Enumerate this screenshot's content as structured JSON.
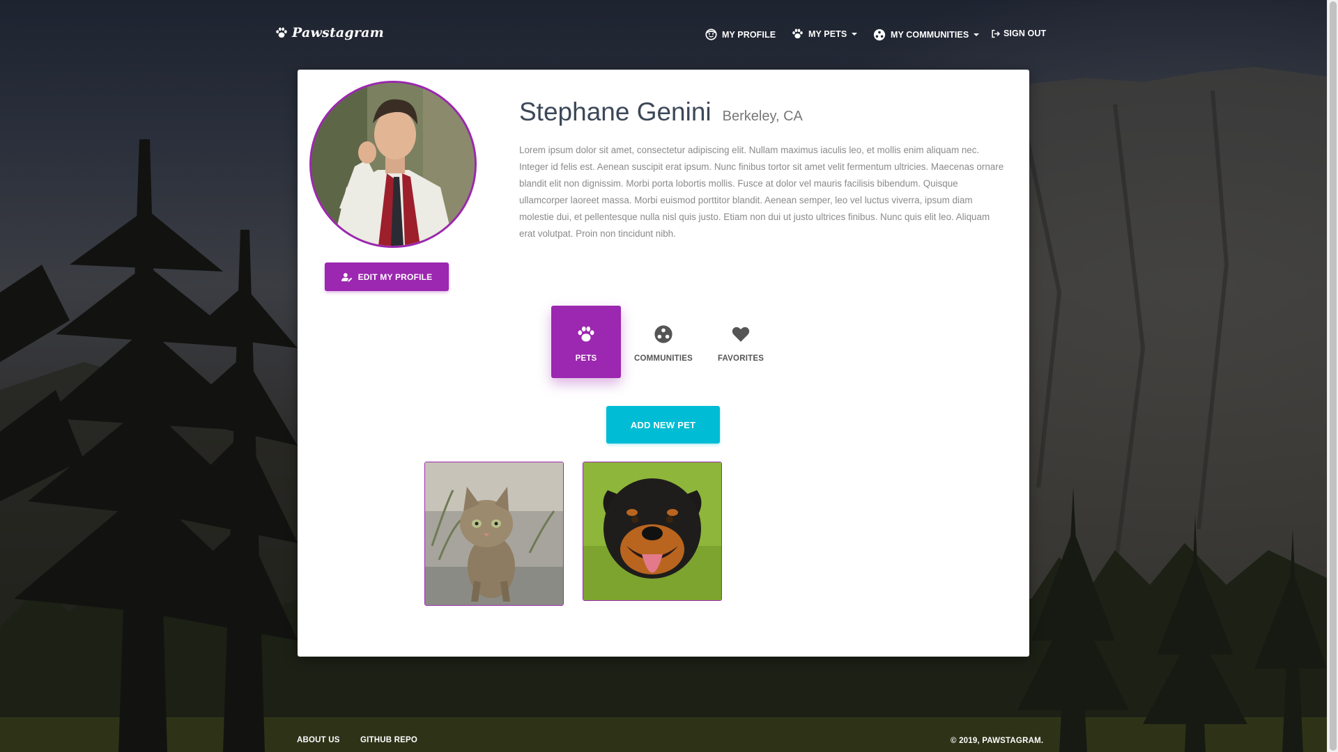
{
  "brand": {
    "name": "Pawstagram",
    "icon": "paw-icon"
  },
  "nav": {
    "items": [
      {
        "label": "MY PROFILE",
        "icon": "face-icon",
        "dropdown": false
      },
      {
        "label": "MY PETS",
        "icon": "paw-icon",
        "dropdown": true
      },
      {
        "label": "MY COMMUNITIES",
        "icon": "group-icon",
        "dropdown": true
      },
      {
        "label": "SIGN OUT",
        "icon": "sign-out-icon",
        "dropdown": false
      }
    ]
  },
  "profile": {
    "name": "Stephane Genini",
    "location": "Berkeley, CA",
    "bio": "Lorem ipsum dolor sit amet, consectetur adipiscing elit. Nullam maximus iaculis leo, et mollis enim aliquam nec. Integer id felis est. Aenean suscipit erat ipsum. Nunc finibus tortor sit amet velit fermentum ultricies. Maecenas ornare blandit elit non dignissim. Morbi porta lobortis mollis. Fusce at dolor vel mauris facilisis bibendum. Quisque ullamcorper laoreet massa. Morbi euismod porttitor blandit. Aenean semper, leo vel luctus viverra, ipsum diam molestie dui, et pellentesque nulla nisl quis justo. Etiam non dui ut justo ultrices finibus. Nunc quis elit leo. Aliquam erat volutpat. Proin non tincidunt nibh.",
    "edit_label": "EDIT MY PROFILE",
    "edit_icon": "person-edit-icon"
  },
  "tabs": [
    {
      "label": "PETS",
      "icon": "paw-icon",
      "active": true
    },
    {
      "label": "COMMUNITIES",
      "icon": "group-icon",
      "active": false
    },
    {
      "label": "FAVORITES",
      "icon": "heart-icon",
      "active": false
    }
  ],
  "pets": {
    "add_label": "ADD NEW PET",
    "items": [
      {
        "kind": "cat"
      },
      {
        "kind": "dog"
      }
    ]
  },
  "footer": {
    "links": [
      "ABOUT US",
      "GITHUB REPO"
    ],
    "copyright": "© 2019, PAWSTAGRAM."
  },
  "colors": {
    "primary": "#9c27b0",
    "info": "#00bcd4",
    "text_dark": "#3c4858",
    "text_muted": "#8a8a8a"
  }
}
